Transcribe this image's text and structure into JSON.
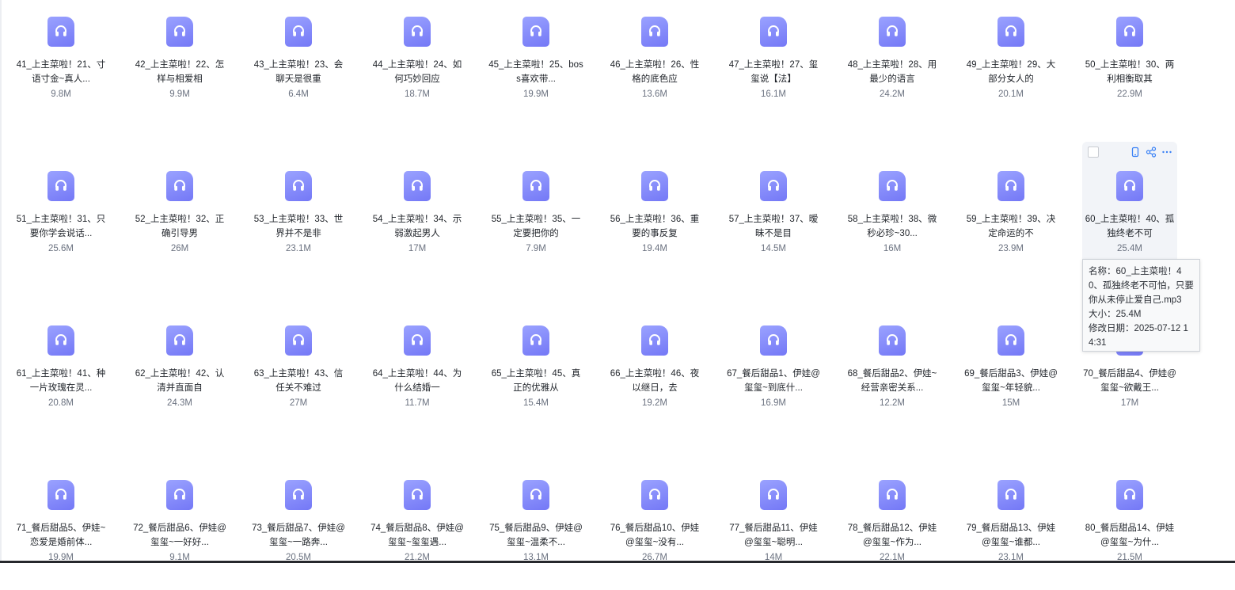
{
  "files": [
    {
      "name": "41_上主菜啦！21、寸语寸金~真人...",
      "size": "9.8M"
    },
    {
      "name": "42_上主菜啦！22、怎样与相爱相",
      "size": "9.9M"
    },
    {
      "name": "43_上主菜啦！23、会聊天是很重",
      "size": "6.4M"
    },
    {
      "name": "44_上主菜啦！24、如何巧妙回应",
      "size": "18.7M"
    },
    {
      "name": "45_上主菜啦！25、boss喜欢带...",
      "size": "19.9M"
    },
    {
      "name": "46_上主菜啦！26、性格的底色应",
      "size": "13.6M"
    },
    {
      "name": "47_上主菜啦！27、玺玺说【法】",
      "size": "16.1M"
    },
    {
      "name": "48_上主菜啦！28、用最少的语言",
      "size": "24.2M"
    },
    {
      "name": "49_上主菜啦！29、大部分女人的",
      "size": "20.1M"
    },
    {
      "name": "50_上主菜啦！30、两利相衡取其",
      "size": "22.9M"
    },
    {
      "name": "51_上主菜啦！31、只要你学会说话...",
      "size": "25.6M"
    },
    {
      "name": "52_上主菜啦！32、正确引导男",
      "size": "26M"
    },
    {
      "name": "53_上主菜啦！33、世界并不是非",
      "size": "23.1M"
    },
    {
      "name": "54_上主菜啦！34、示弱激起男人",
      "size": "17M"
    },
    {
      "name": "55_上主菜啦！35、一定要把你的",
      "size": "7.9M"
    },
    {
      "name": "56_上主菜啦！36、重要的事反复",
      "size": "19.4M"
    },
    {
      "name": "57_上主菜啦！37、暧昧不是目",
      "size": "14.5M"
    },
    {
      "name": "58_上主菜啦！38、微秒必珍~30...",
      "size": "16M"
    },
    {
      "name": "59_上主菜啦！39、决定命运的不",
      "size": "23.9M"
    },
    {
      "name": "60_上主菜啦！40、孤独终老不可",
      "size": "25.4M"
    },
    {
      "name": "61_上主菜啦！41、种一片玫瑰在灵...",
      "size": "20.8M"
    },
    {
      "name": "62_上主菜啦！42、认清并直面自",
      "size": "24.3M"
    },
    {
      "name": "63_上主菜啦！43、信任关不难过",
      "size": "27M"
    },
    {
      "name": "64_上主菜啦！44、为什么结婚一",
      "size": "11.7M"
    },
    {
      "name": "65_上主菜啦！45、真正的优雅从",
      "size": "15.4M"
    },
    {
      "name": "66_上主菜啦！46、夜以继日，去",
      "size": "19.2M"
    },
    {
      "name": "67_餐后甜品1、伊娃@玺玺~到底什...",
      "size": "16.9M"
    },
    {
      "name": "68_餐后甜品2、伊娃~经营亲密关系...",
      "size": "12.2M"
    },
    {
      "name": "69_餐后甜品3、伊娃@玺玺~年轻貌...",
      "size": "15M"
    },
    {
      "name": "70_餐后甜品4、伊娃@玺玺~欲戴王...",
      "size": "17M"
    },
    {
      "name": "71_餐后甜品5、伊娃~恋爱是婚前体...",
      "size": "19.9M"
    },
    {
      "name": "72_餐后甜品6、伊娃@玺玺~一好好...",
      "size": "9.1M"
    },
    {
      "name": "73_餐后甜品7、伊娃@玺玺~一路奔...",
      "size": "20.5M"
    },
    {
      "name": "74_餐后甜品8、伊娃@玺玺~玺玺遇...",
      "size": "21.2M"
    },
    {
      "name": "75_餐后甜品9、伊娃@玺玺~温柔不...",
      "size": "13.1M"
    },
    {
      "name": "76_餐后甜品10、伊娃@玺玺~没有...",
      "size": "26.7M"
    },
    {
      "name": "77_餐后甜品11、伊娃@玺玺~聪明...",
      "size": "14M"
    },
    {
      "name": "78_餐后甜品12、伊娃@玺玺~作为...",
      "size": "22.1M"
    },
    {
      "name": "79_餐后甜品13、伊娃@玺玺~谁都...",
      "size": "23.1M"
    },
    {
      "name": "80_餐后甜品14、伊娃@玺玺~为什...",
      "size": "21.5M"
    }
  ],
  "hovered_index": 19,
  "tooltip": {
    "name_line": "名称：60_上主菜啦！40、孤独终老不可怕，只要你从未停止爱自己.mp3",
    "size_line": "大小：25.4M",
    "date_line": "修改日期：2025-07-12 14:31"
  },
  "icons": {
    "file": "headphones-icon",
    "hover_actions": [
      "phone-icon",
      "share-icon",
      "more-icon"
    ]
  },
  "colors": {
    "icon_start": "#9aa2ff",
    "icon_end": "#7478f6",
    "action": "#3b82f6"
  }
}
